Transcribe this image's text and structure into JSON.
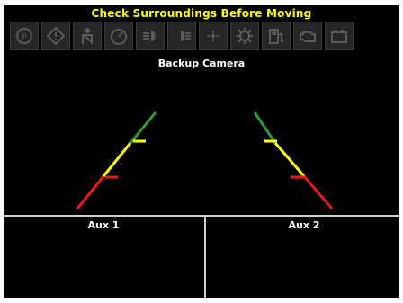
{
  "header": {
    "warning": "Check Surroundings Before Moving"
  },
  "toolbar": {
    "icons": [
      {
        "name": "park-brake-icon"
      },
      {
        "name": "warning-icon"
      },
      {
        "name": "seatbelt-icon"
      },
      {
        "name": "gauge-icon"
      },
      {
        "name": "low-beam-icon"
      },
      {
        "name": "high-beam-icon"
      },
      {
        "name": "fan-icon"
      },
      {
        "name": "diagnostic-icon"
      },
      {
        "name": "fuel-icon"
      },
      {
        "name": "engine-icon"
      },
      {
        "name": "battery-icon"
      }
    ],
    "icon_color": "#5a5a5a"
  },
  "camera": {
    "title": "Backup Camera"
  },
  "guide_colors": {
    "green": "#2f9a2f",
    "yellow": "#ffff00",
    "red": "#e51b1b"
  },
  "aux_panels": [
    {
      "label": "Aux 1"
    },
    {
      "label": "Aux 2"
    }
  ]
}
